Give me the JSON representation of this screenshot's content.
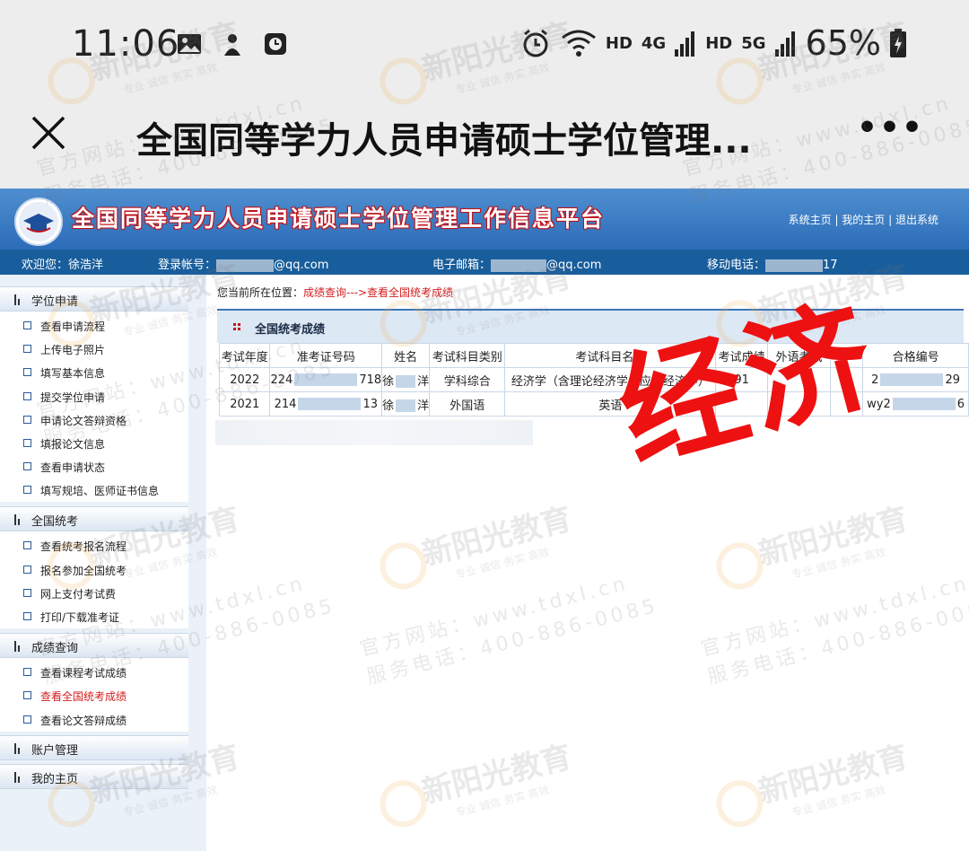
{
  "status_bar": {
    "time": "11:06",
    "network_labels": [
      "HD",
      "4G",
      "HD",
      "5G"
    ],
    "battery": "65%"
  },
  "title_bar": {
    "title": "全国同等学力人员申请硕士学位管理...",
    "more": "•••"
  },
  "header": {
    "site_title": "全国同等学力人员申请硕士学位管理工作信息平台",
    "nav": [
      "系统主页",
      "我的主页",
      "退出系统"
    ],
    "nav_sep": " | "
  },
  "user_bar": {
    "welcome": "欢迎您：徐浩洋",
    "account_label": "登录帐号：",
    "account_suffix": "@qq.com",
    "email_label": "电子邮箱：",
    "email_suffix": "@qq.com",
    "phone_label": "移动电话：",
    "phone_suffix": "17"
  },
  "sidebar": {
    "sections": [
      {
        "label": "学位申请",
        "items": [
          "查看申请流程",
          "上传电子照片",
          "填写基本信息",
          "提交学位申请",
          "申请论文答辩资格",
          "填报论文信息",
          "查看申请状态",
          "填写规培、医师证书信息"
        ]
      },
      {
        "label": "全国统考",
        "items": [
          "查看统考报名流程",
          "报名参加全国统考",
          "网上支付考试费",
          "打印/下载准考证"
        ]
      },
      {
        "label": "成绩查询",
        "items": [
          "查看课程考试成绩",
          "查看全国统考成绩",
          "查看论文答辩成绩"
        ],
        "active": "查看全国统考成绩"
      },
      {
        "label": "账户管理",
        "items": []
      },
      {
        "label": "我的主页",
        "items": []
      }
    ]
  },
  "main": {
    "location_label": "您当前所在位置：",
    "location_path": "成绩查询--->查看全国统考成绩",
    "panel_title": "全国统考成绩",
    "table": {
      "headers": [
        "考试年度",
        "准考证号码",
        "姓名",
        "考试科目类别",
        "考试科目名称",
        "考试成绩",
        "外语考试",
        "",
        "合格编号"
      ],
      "rows": [
        {
          "year": "2022",
          "ticket_pre": "224",
          "ticket_post": "718",
          "name_pre": "徐",
          "name_post": "洋",
          "category": "学科综合",
          "subject": "经济学（含理论经济学、应用经济学）",
          "score": "91",
          "cert_pre": "2",
          "cert_post": "29"
        },
        {
          "year": "2021",
          "ticket_pre": "214",
          "ticket_post": "13",
          "name_pre": "徐",
          "name_post": "洋",
          "category": "外国语",
          "subject": "英语",
          "score": "",
          "cert_pre": "wy2",
          "cert_post": "6"
        }
      ]
    }
  },
  "overlay": {
    "stamp_text": "经济"
  },
  "watermark": {
    "brand": "新阳光教育",
    "tagline": "专业  诚信  务实  高效",
    "site": "官方网站：www.tdxl.cn",
    "phone": "服务电话：400-886-0085"
  },
  "colors": {
    "header_blue": "#2c6cb8",
    "user_bar": "#195e9c",
    "active_link": "#d42020",
    "stamp_red": "#ee1111"
  }
}
